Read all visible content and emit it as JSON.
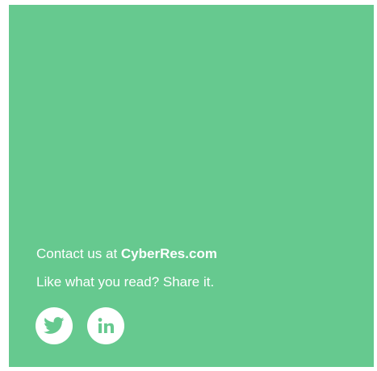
{
  "contact": {
    "prefix": "Contact us at ",
    "website": "CyberRes.com"
  },
  "share": {
    "text": "Like what you read? Share it."
  },
  "social": {
    "twitter_icon": "twitter-icon",
    "linkedin_icon": "linkedin-icon"
  },
  "colors": {
    "background": "#66c98f",
    "foreground": "#ffffff"
  }
}
